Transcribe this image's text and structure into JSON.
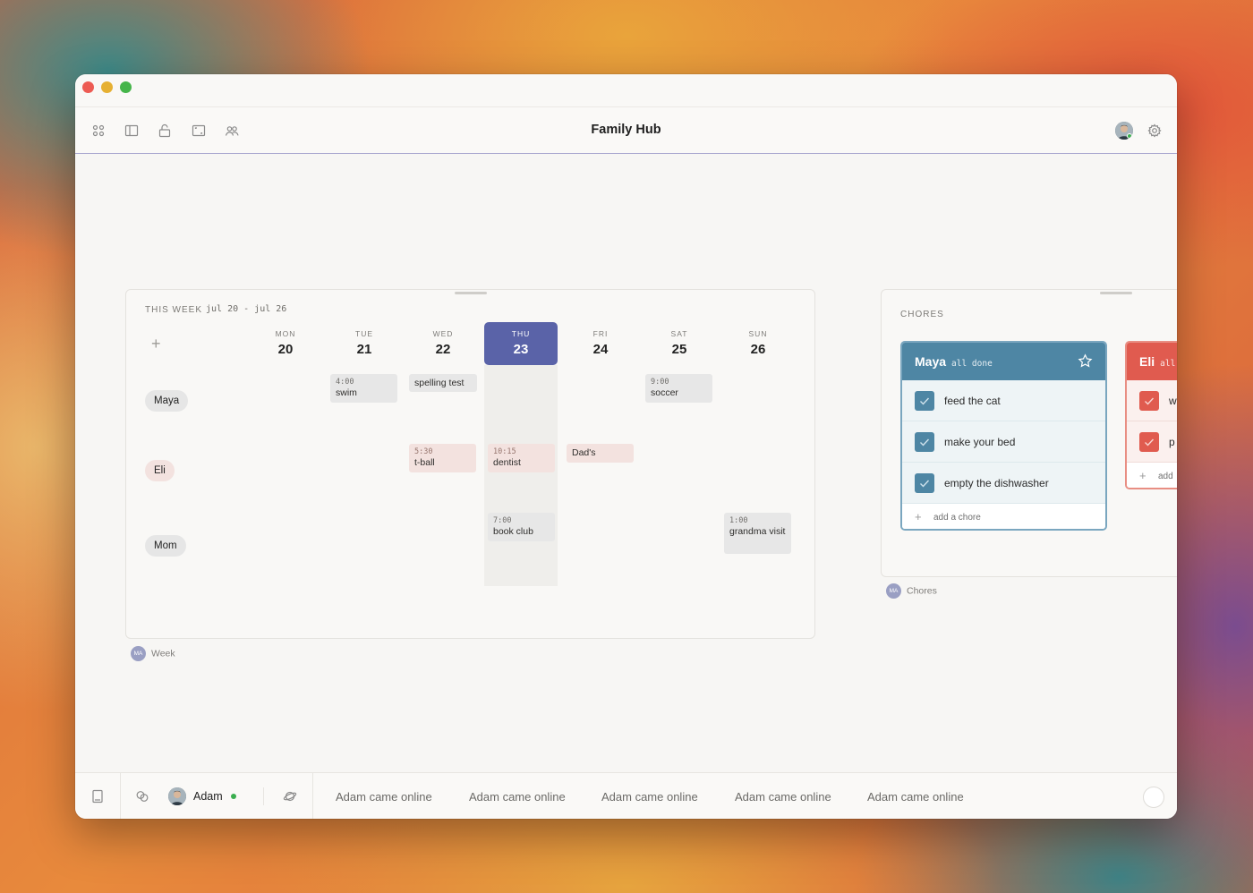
{
  "app": {
    "title": "Family Hub"
  },
  "week": {
    "label": "THIS WEEK",
    "range": "jul 20 - jul 26",
    "add_label": "+",
    "days": [
      {
        "name": "MON",
        "num": "20"
      },
      {
        "name": "TUE",
        "num": "21"
      },
      {
        "name": "WED",
        "num": "22"
      },
      {
        "name": "THU",
        "num": "23",
        "today": true
      },
      {
        "name": "FRI",
        "num": "24"
      },
      {
        "name": "SAT",
        "num": "25"
      },
      {
        "name": "SUN",
        "num": "26"
      }
    ],
    "people": [
      "Maya",
      "Eli",
      "Mom"
    ],
    "events": {
      "maya_tue": {
        "time": "4:00",
        "title": "swim"
      },
      "maya_wed": {
        "title": "spelling test"
      },
      "maya_sat": {
        "time": "9:00",
        "title": "soccer"
      },
      "eli_wed": {
        "time": "5:30",
        "title": "t-ball"
      },
      "eli_thu": {
        "time": "10:15",
        "title": "dentist"
      },
      "eli_fri": {
        "title": "Dad's"
      },
      "mom_thu": {
        "time": "7:00",
        "title": "book club"
      },
      "mom_sun": {
        "time": "1:00",
        "title": "grandma visit"
      }
    },
    "footer": {
      "badge": "MA",
      "label": "Week"
    }
  },
  "chores": {
    "title": "CHORES",
    "lists": [
      {
        "name": "Maya",
        "status": "all done",
        "color": "#4e86a4",
        "items": [
          "feed the cat",
          "make your bed",
          "empty the dishwasher"
        ],
        "add_label": "add a chore"
      },
      {
        "name": "Eli",
        "status": "all",
        "color": "#e05b4f",
        "items": [
          "w",
          "p"
        ],
        "add_label": "add"
      }
    ],
    "footer": {
      "badge": "MA",
      "label": "Chores"
    }
  },
  "bottom": {
    "user": "Adam",
    "notifications": [
      "Adam came online",
      "Adam came online",
      "Adam came online",
      "Adam came online",
      "Adam came online"
    ]
  },
  "colors": {
    "accent": "#5a63a8",
    "maya": "#4e86a4",
    "eli": "#e05b4f"
  }
}
